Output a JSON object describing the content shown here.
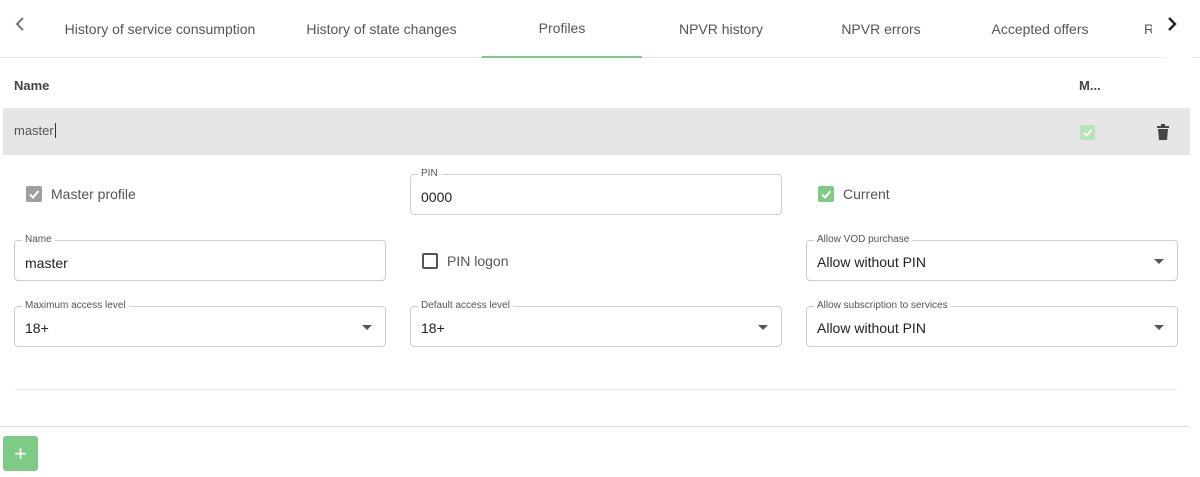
{
  "tabs": [
    {
      "label": "History of service consumption",
      "active": false
    },
    {
      "label": "History of state changes",
      "active": false
    },
    {
      "label": "Profiles",
      "active": true
    },
    {
      "label": "NPVR history",
      "active": false
    },
    {
      "label": "NPVR errors",
      "active": false
    },
    {
      "label": "Accepted offers",
      "active": false
    },
    {
      "label": "Re",
      "active": false
    }
  ],
  "table": {
    "columns": [
      "Name",
      "M..."
    ],
    "rows": [
      {
        "name": "master",
        "master": true
      }
    ]
  },
  "form": {
    "master_profile": {
      "label": "Master profile",
      "checked": true
    },
    "pin": {
      "label": "PIN",
      "value": "0000"
    },
    "current": {
      "label": "Current",
      "checked": true
    },
    "name": {
      "label": "Name",
      "value": "master"
    },
    "pin_logon": {
      "label": "PIN logon",
      "checked": false
    },
    "allow_vod_purchase": {
      "label": "Allow VOD purchase",
      "value": "Allow without PIN"
    },
    "max_access_level": {
      "label": "Maximum access level",
      "value": "18+"
    },
    "default_access_level": {
      "label": "Default access level",
      "value": "18+"
    },
    "allow_subscription": {
      "label": "Allow subscription to services",
      "value": "Allow without PIN"
    }
  },
  "add_button": {
    "label": "+"
  },
  "colors": {
    "accent": "#7dcb85",
    "row_bg": "#e6e6e6"
  }
}
